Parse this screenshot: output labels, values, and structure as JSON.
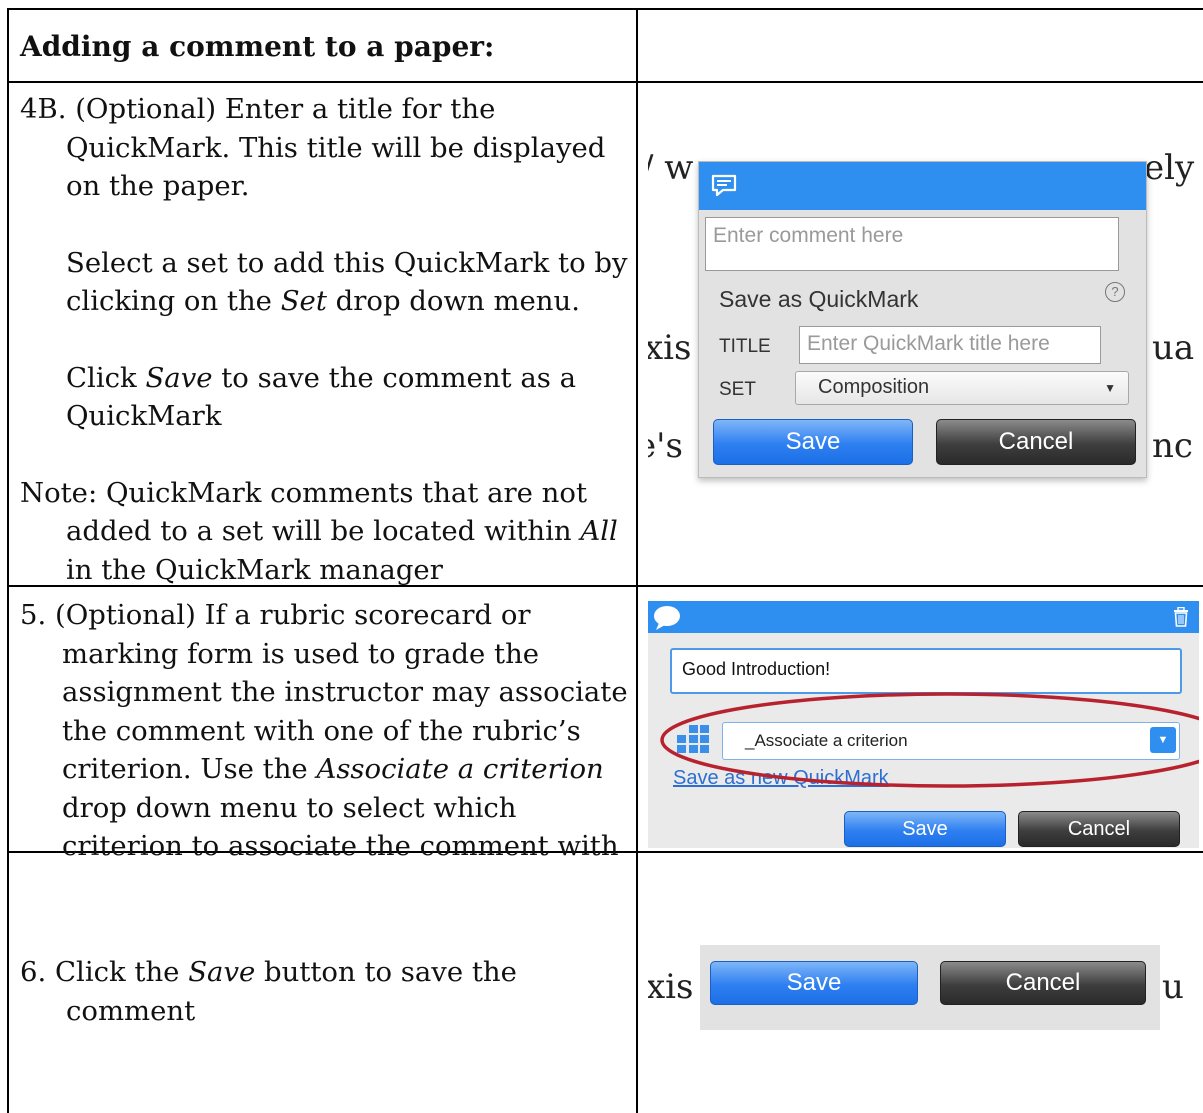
{
  "header": {
    "title": "Adding a comment to a paper:"
  },
  "step4b": {
    "p1": "4B. (Optional) Enter a title for the QuickMark. This title will be displayed on the paper.",
    "p2": "Select a set to add this QuickMark to by clicking on the",
    "p2_em": "Set",
    "p2_end": "drop down menu.",
    "p3": "Click",
    "p3_em": "Save",
    "p3_end": "to save the comment as a QuickMark",
    "note": "Note: QuickMark comments that are not added to a set will be located within",
    "note_em": "All",
    "note_end": "in the QuickMark manager"
  },
  "step5": {
    "text": "5. (Optional) If a rubric scorecard or marking form is used to grade the assignment the instructor may associate the comment with one of the rubric’s criterion. Use the",
    "text_em": "Associate a criterion",
    "text_end": "drop down menu to select which criterion to associate the comment with"
  },
  "step6": {
    "text": "6. Click the",
    "text_em": "Save",
    "text_end": "button to save the comment"
  },
  "shot1": {
    "bg_left_top": "w",
    "bg_right_top": "ely",
    "bg_left_mid": "xis",
    "bg_right_mid": "ua",
    "bg_left_bot": "e's",
    "bg_right_bot": "nc",
    "comment_placeholder": "Enter comment here",
    "save_as_label": "Save as QuickMark",
    "help_glyph": "?",
    "title_label": "TITLE",
    "title_placeholder": "Enter QuickMark title here",
    "set_label": "SET",
    "set_value": "Composition",
    "save_label": "Save",
    "cancel_label": "Cancel"
  },
  "shot2": {
    "comment_value": "Good Introduction!",
    "criterion_value": "_Associate a criterion",
    "link_label": "Save as new QuickMark",
    "save_label": "Save",
    "cancel_label": "Cancel"
  },
  "shot3": {
    "bg_left": "xis",
    "bg_right": "u",
    "save_label": "Save",
    "cancel_label": "Cancel"
  },
  "colors": {
    "accent_blue": "#2f8ff0",
    "highlight_red": "#b8222f"
  }
}
